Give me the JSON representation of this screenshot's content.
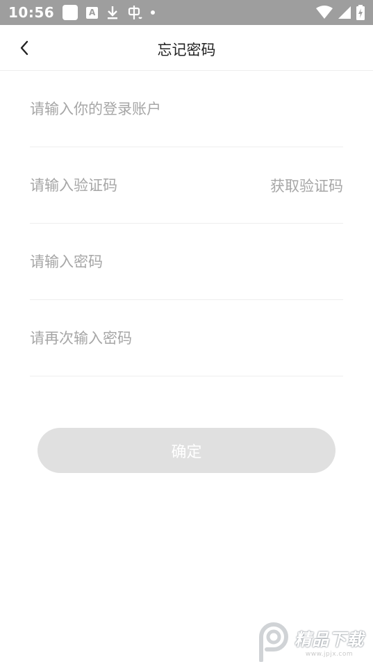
{
  "status_bar": {
    "time": "10:56",
    "left_icons": [
      "notification-square-icon",
      "a-app-icon",
      "download-icon",
      "bug-icon",
      "dot-icon"
    ],
    "right_icons": [
      "wifi-icon",
      "signal-icon",
      "battery-charging-icon"
    ],
    "background": "#9e9e9e"
  },
  "header": {
    "title": "忘记密码",
    "back_icon": "chevron-left-icon"
  },
  "form": {
    "account_placeholder": "请输入你的登录账户",
    "code_placeholder": "请输入验证码",
    "get_code_label": "获取验证码",
    "password_placeholder": "请输入密码",
    "confirm_password_placeholder": "请再次输入密码"
  },
  "submit": {
    "label": "确定",
    "background": "#e0e0e0"
  },
  "watermark": {
    "text": "精品下载",
    "subtext": "www.jpjx.com"
  }
}
